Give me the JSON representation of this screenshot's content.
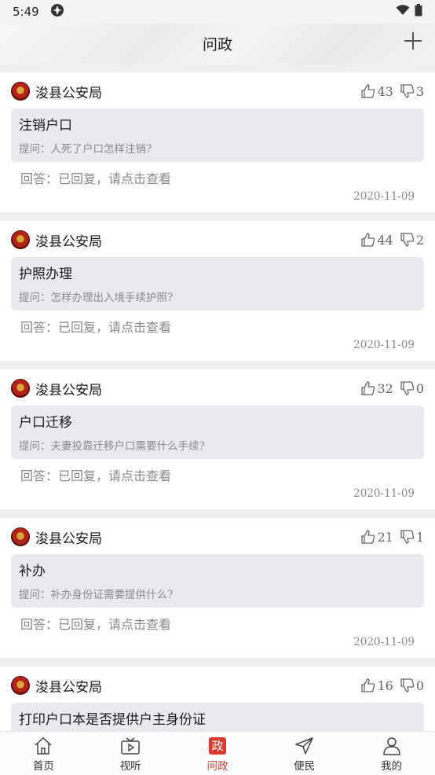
{
  "status_bar": {
    "time": "5:49"
  },
  "header": {
    "title": "问政"
  },
  "posts": [
    {
      "org": "浚县公安局",
      "likes": "43",
      "dislikes": "3",
      "title": "注销户口",
      "question": "提问：人死了户口怎样注销?",
      "answer": "回答：已回复，请点击查看",
      "date": "2020-11-09"
    },
    {
      "org": "浚县公安局",
      "likes": "44",
      "dislikes": "2",
      "title": "护照办理",
      "question": "提问：怎样办理出入境手续护照?",
      "answer": "回答：已回复，请点击查看",
      "date": "2020-11-09"
    },
    {
      "org": "浚县公安局",
      "likes": "32",
      "dislikes": "0",
      "title": "户口迁移",
      "question": "提问：夫妻投靠迁移户口需要什么手续?",
      "answer": "回答：已回复，请点击查看",
      "date": "2020-11-09"
    },
    {
      "org": "浚县公安局",
      "likes": "21",
      "dislikes": "1",
      "title": "补办",
      "question": "提问：补办身份证需要提供什么?",
      "answer": "回答：已回复，请点击查看",
      "date": "2020-11-09"
    },
    {
      "org": "浚县公安局",
      "likes": "16",
      "dislikes": "0",
      "title": "打印户口本是否提供户主身份证",
      "question": "",
      "answer": "",
      "date": ""
    }
  ],
  "tabbar": {
    "items": [
      {
        "label": "首页",
        "icon": "home-icon"
      },
      {
        "label": "视听",
        "icon": "tv-play-icon"
      },
      {
        "label": "问政",
        "icon": "zheng-badge-icon",
        "badge": "政",
        "active": true
      },
      {
        "label": "便民",
        "icon": "paper-plane-icon"
      },
      {
        "label": "我的",
        "icon": "user-icon"
      }
    ]
  },
  "colors": {
    "accent": "#d93b2e",
    "card_bg": "#ffffff",
    "question_bg": "#e8eaef",
    "page_bg": "#efefef"
  }
}
